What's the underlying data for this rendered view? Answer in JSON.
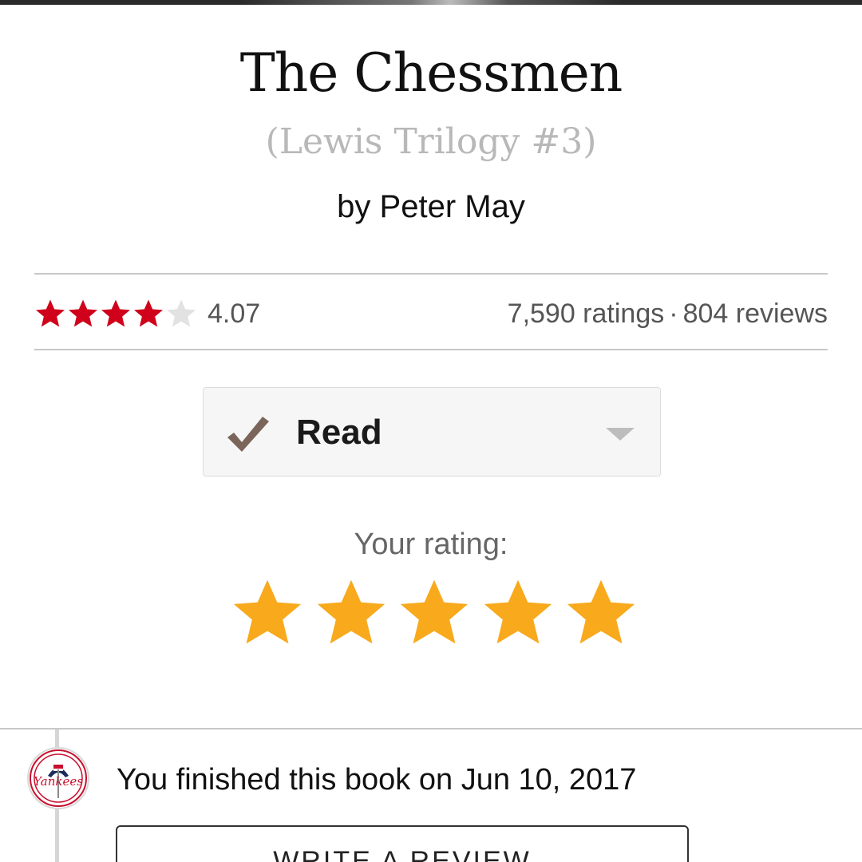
{
  "book": {
    "title": "The Chessmen",
    "series": "(Lewis Trilogy #3)",
    "author": "by Peter May"
  },
  "ratings_bar": {
    "average_rating": "4.07",
    "average_stars_filled": 4.07,
    "stars_max": 5,
    "ratings_count": "7,590 ratings",
    "separator": "·",
    "reviews_count": "804 reviews",
    "star_color_filled": "#d0021b",
    "star_color_empty": "#e2e2e2"
  },
  "shelf": {
    "status_label": "Read",
    "check_icon": "check-icon",
    "check_color": "#7b655a",
    "dropdown_icon": "chevron-down-icon"
  },
  "user_rating": {
    "label": "Your rating:",
    "stars_filled": 5,
    "stars_max": 5,
    "star_color": "#f8a91c"
  },
  "activity": {
    "avatar_icon": "yankees-logo-avatar",
    "avatar_text": "Yankees",
    "message": "You finished this book on Jun 10, 2017",
    "write_review_label": "WRITE A REVIEW"
  }
}
